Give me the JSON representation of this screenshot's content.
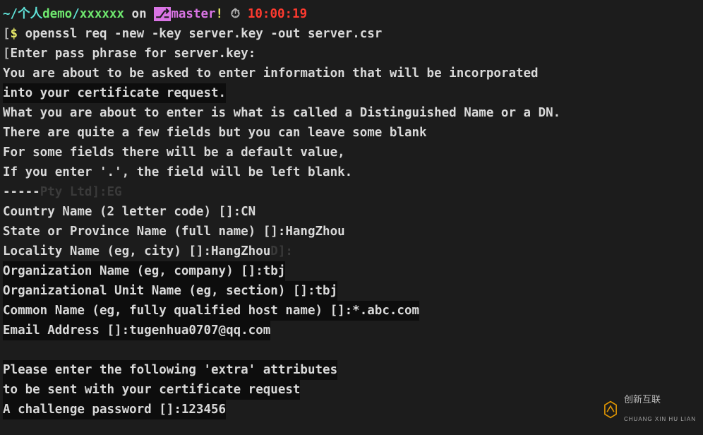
{
  "prompt": {
    "path1": "~/",
    "path2": "个人",
    "demo": "demo",
    "slash": "/",
    "xxx": "xxxxxx",
    "on": " on ",
    "branch_icon": "⎇",
    "branch": "master",
    "bang": "!",
    "clock_icon": "⏱",
    "time": "10:00:19"
  },
  "cmd": {
    "symbol": "$ ",
    "text": "openssl req -new -key server.key -out server.csr"
  },
  "lines": {
    "l1": "Enter pass phrase for server.key:",
    "l2": "You are about to be asked to enter information that will be incorporated",
    "l3": "into your certificate request.",
    "l4": "What you are about to enter is what is called a Distinguished Name or a DN.",
    "l5": "There are quite a few fields but you can leave some blank",
    "l6": "For some fields there will be a default value,",
    "l7": "If you enter '.', the field will be left blank.",
    "l8": "-----",
    "g8": "Pty Ltd]:EG",
    "l9": "Country Name (2 letter code) []:CN",
    "l10": "State or Province Name (full name) []:HangZhou",
    "l11": "Locality Name (eg, city) []:HangZhou",
    "g11": "D]:",
    "l12": "Organization Name (eg, company) []:tbj",
    "l13": "Organizational Unit Name (eg, section) []:tbj",
    "l14": "Common Name (eg, fully qualified host name) []:*.abc.com",
    "l15": "Email Address []:tugenhua0707@qq.com",
    "l16": "",
    "l17": "Please enter the following 'extra' attributes",
    "l18": "to be sent with your certificate request",
    "l19": "A challenge password []:123456"
  },
  "watermark": {
    "brand": "创新互联",
    "sub": "CHUANG XIN HU LIAN"
  }
}
